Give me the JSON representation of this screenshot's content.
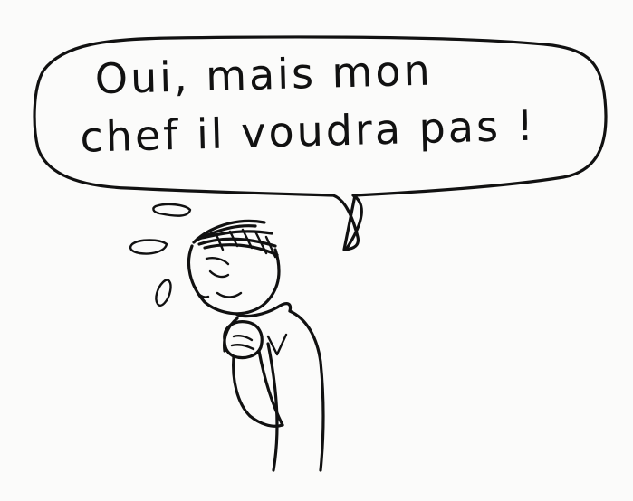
{
  "speech_bubble": {
    "line_1": "Oui, mais mon",
    "line_2": "chef il voudra pas !"
  },
  "colors": {
    "ink": "#111111",
    "paper": "#fbfbfa"
  },
  "illustration": {
    "subject": "worried-person-sweating",
    "icons": [
      "speech-bubble-icon",
      "sweat-drop-icon",
      "person-icon"
    ]
  }
}
